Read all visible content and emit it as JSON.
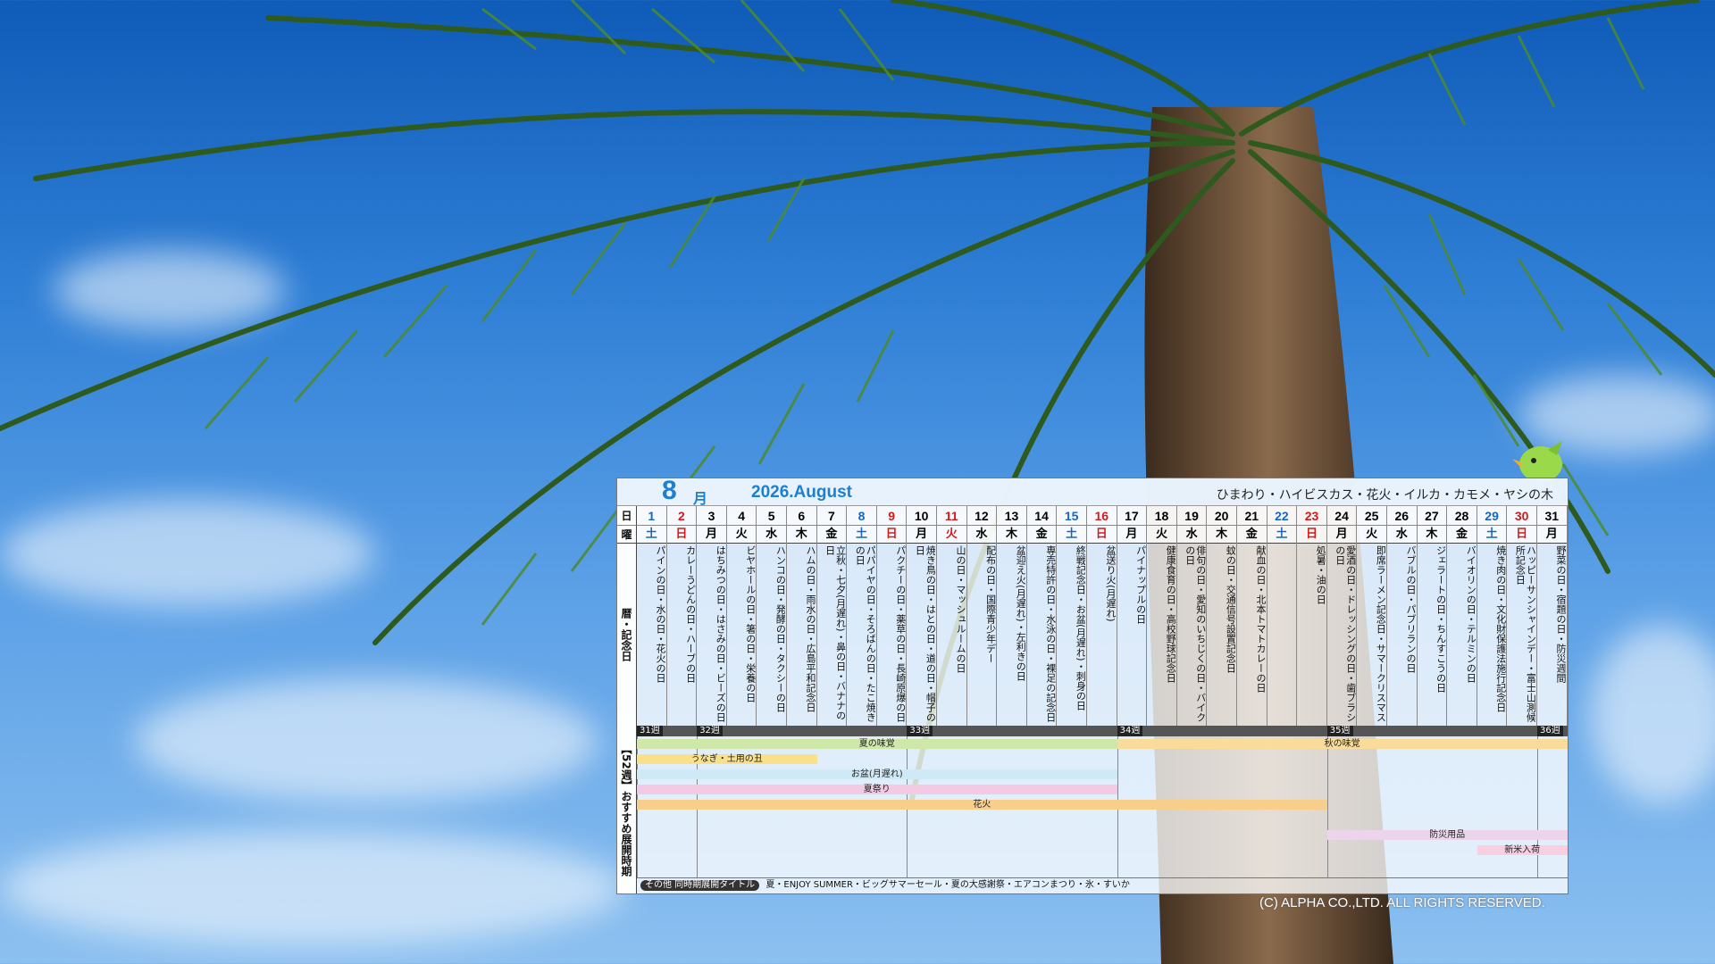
{
  "header": {
    "month_number": "8",
    "month_suffix": "月",
    "year_title": "2026.August",
    "motifs": "ひまわり・ハイビスカス・花火・イルカ・カモメ・ヤシの木"
  },
  "row_labels": {
    "day": "日",
    "weekday": "曜",
    "events": "暦・記念日",
    "promo": "【52週】おすすめ展開時期"
  },
  "days": [
    {
      "d": "1",
      "w": "土",
      "c": "blue",
      "e": "パインの日・水の日・花火の日"
    },
    {
      "d": "2",
      "w": "日",
      "c": "red",
      "e": "カレーうどんの日・ハーブの日"
    },
    {
      "d": "3",
      "w": "月",
      "c": "",
      "e": "はちみつの日・はさみの日・ビーズの日"
    },
    {
      "d": "4",
      "w": "火",
      "c": "",
      "e": "ビヤホールの日・箸の日・栄養の日"
    },
    {
      "d": "5",
      "w": "水",
      "c": "",
      "e": "ハンコの日・発酵の日・タクシーの日"
    },
    {
      "d": "6",
      "w": "木",
      "c": "",
      "e": "ハムの日・雨水の日・広島平和記念日"
    },
    {
      "d": "7",
      "w": "金",
      "c": "",
      "e": "立秋・七夕(月遅れ)・鼻の日・バナナの日"
    },
    {
      "d": "8",
      "w": "土",
      "c": "blue",
      "e": "パパイヤの日・そろばんの日・たこ焼きの日"
    },
    {
      "d": "9",
      "w": "日",
      "c": "red",
      "e": "パクチーの日・薬草の日・長崎原爆の日"
    },
    {
      "d": "10",
      "w": "月",
      "c": "",
      "e": "焼き鳥の日・はとの日・道の日・帽子の日"
    },
    {
      "d": "11",
      "w": "火",
      "c": "red",
      "e": "山の日・マッシュルームの日"
    },
    {
      "d": "12",
      "w": "水",
      "c": "",
      "e": "配布の日・国際青少年デー"
    },
    {
      "d": "13",
      "w": "木",
      "c": "",
      "e": "盆迎え火(月遅れ)・左利きの日"
    },
    {
      "d": "14",
      "w": "金",
      "c": "",
      "e": "専売特許の日・水泳の日・裸足の記念日"
    },
    {
      "d": "15",
      "w": "土",
      "c": "blue",
      "e": "終戦記念日・お盆(月遅れ)・刺身の日"
    },
    {
      "d": "16",
      "w": "日",
      "c": "red",
      "e": "盆送り火(月遅れ)"
    },
    {
      "d": "17",
      "w": "月",
      "c": "",
      "e": "パイナップルの日"
    },
    {
      "d": "18",
      "w": "火",
      "c": "",
      "e": "健康食育の日・高校野球記念日"
    },
    {
      "d": "19",
      "w": "水",
      "c": "",
      "e": "俳句の日・愛知のいちじくの日・バイクの日"
    },
    {
      "d": "20",
      "w": "木",
      "c": "",
      "e": "蚊の日・交通信号設置記念日"
    },
    {
      "d": "21",
      "w": "金",
      "c": "",
      "e": "献血の日・北本トマトカレーの日"
    },
    {
      "d": "22",
      "w": "土",
      "c": "blue",
      "e": ""
    },
    {
      "d": "23",
      "w": "日",
      "c": "red",
      "e": "処暑・油の日"
    },
    {
      "d": "24",
      "w": "月",
      "c": "",
      "e": "愛酒の日・ドレッシングの日・歯ブラシの日"
    },
    {
      "d": "25",
      "w": "火",
      "c": "",
      "e": "即席ラーメン記念日・サマークリスマス"
    },
    {
      "d": "26",
      "w": "水",
      "c": "",
      "e": "バブルの日・パブリランの日"
    },
    {
      "d": "27",
      "w": "木",
      "c": "",
      "e": "ジェラートの日・ちんすこうの日"
    },
    {
      "d": "28",
      "w": "金",
      "c": "",
      "e": "バイオリンの日・テルミンの日"
    },
    {
      "d": "29",
      "w": "土",
      "c": "blue",
      "e": "焼き肉の日・文化財保護法施行記念日"
    },
    {
      "d": "30",
      "w": "日",
      "c": "red",
      "e": "ハッピーサンシャインデー・富士山測候所記念日"
    },
    {
      "d": "31",
      "w": "月",
      "c": "",
      "e": "野菜の日・宿題の日・防災週間"
    }
  ],
  "weeks": [
    "31週",
    "32週",
    "33週",
    "34週",
    "35週",
    "36週"
  ],
  "promos": [
    {
      "label": "夏の味覚",
      "color": "#cfe7a9"
    },
    {
      "label": "秋の味覚",
      "color": "#f9dc9a"
    },
    {
      "label": "うなぎ・土用の丑",
      "color": "#fbe08a"
    },
    {
      "label": "お盆(月遅れ)",
      "color": "#cfe9f7"
    },
    {
      "label": "夏祭り",
      "color": "#f3c9e3"
    },
    {
      "label": "花火",
      "color": "#f8cf8a"
    },
    {
      "label": "防災用品",
      "color": "#ecd5ec"
    },
    {
      "label": "新米入荷",
      "color": "#f8cfe0"
    }
  ],
  "footer": {
    "label": "その他 同時期展開タイトル",
    "text": "夏・ENJOY SUMMER・ビッグサマーセール・夏の大感謝祭・エアコンまつり・氷・すいか"
  },
  "copyright": "(C) ALPHA CO.,LTD. ALL RIGHTS RESERVED."
}
